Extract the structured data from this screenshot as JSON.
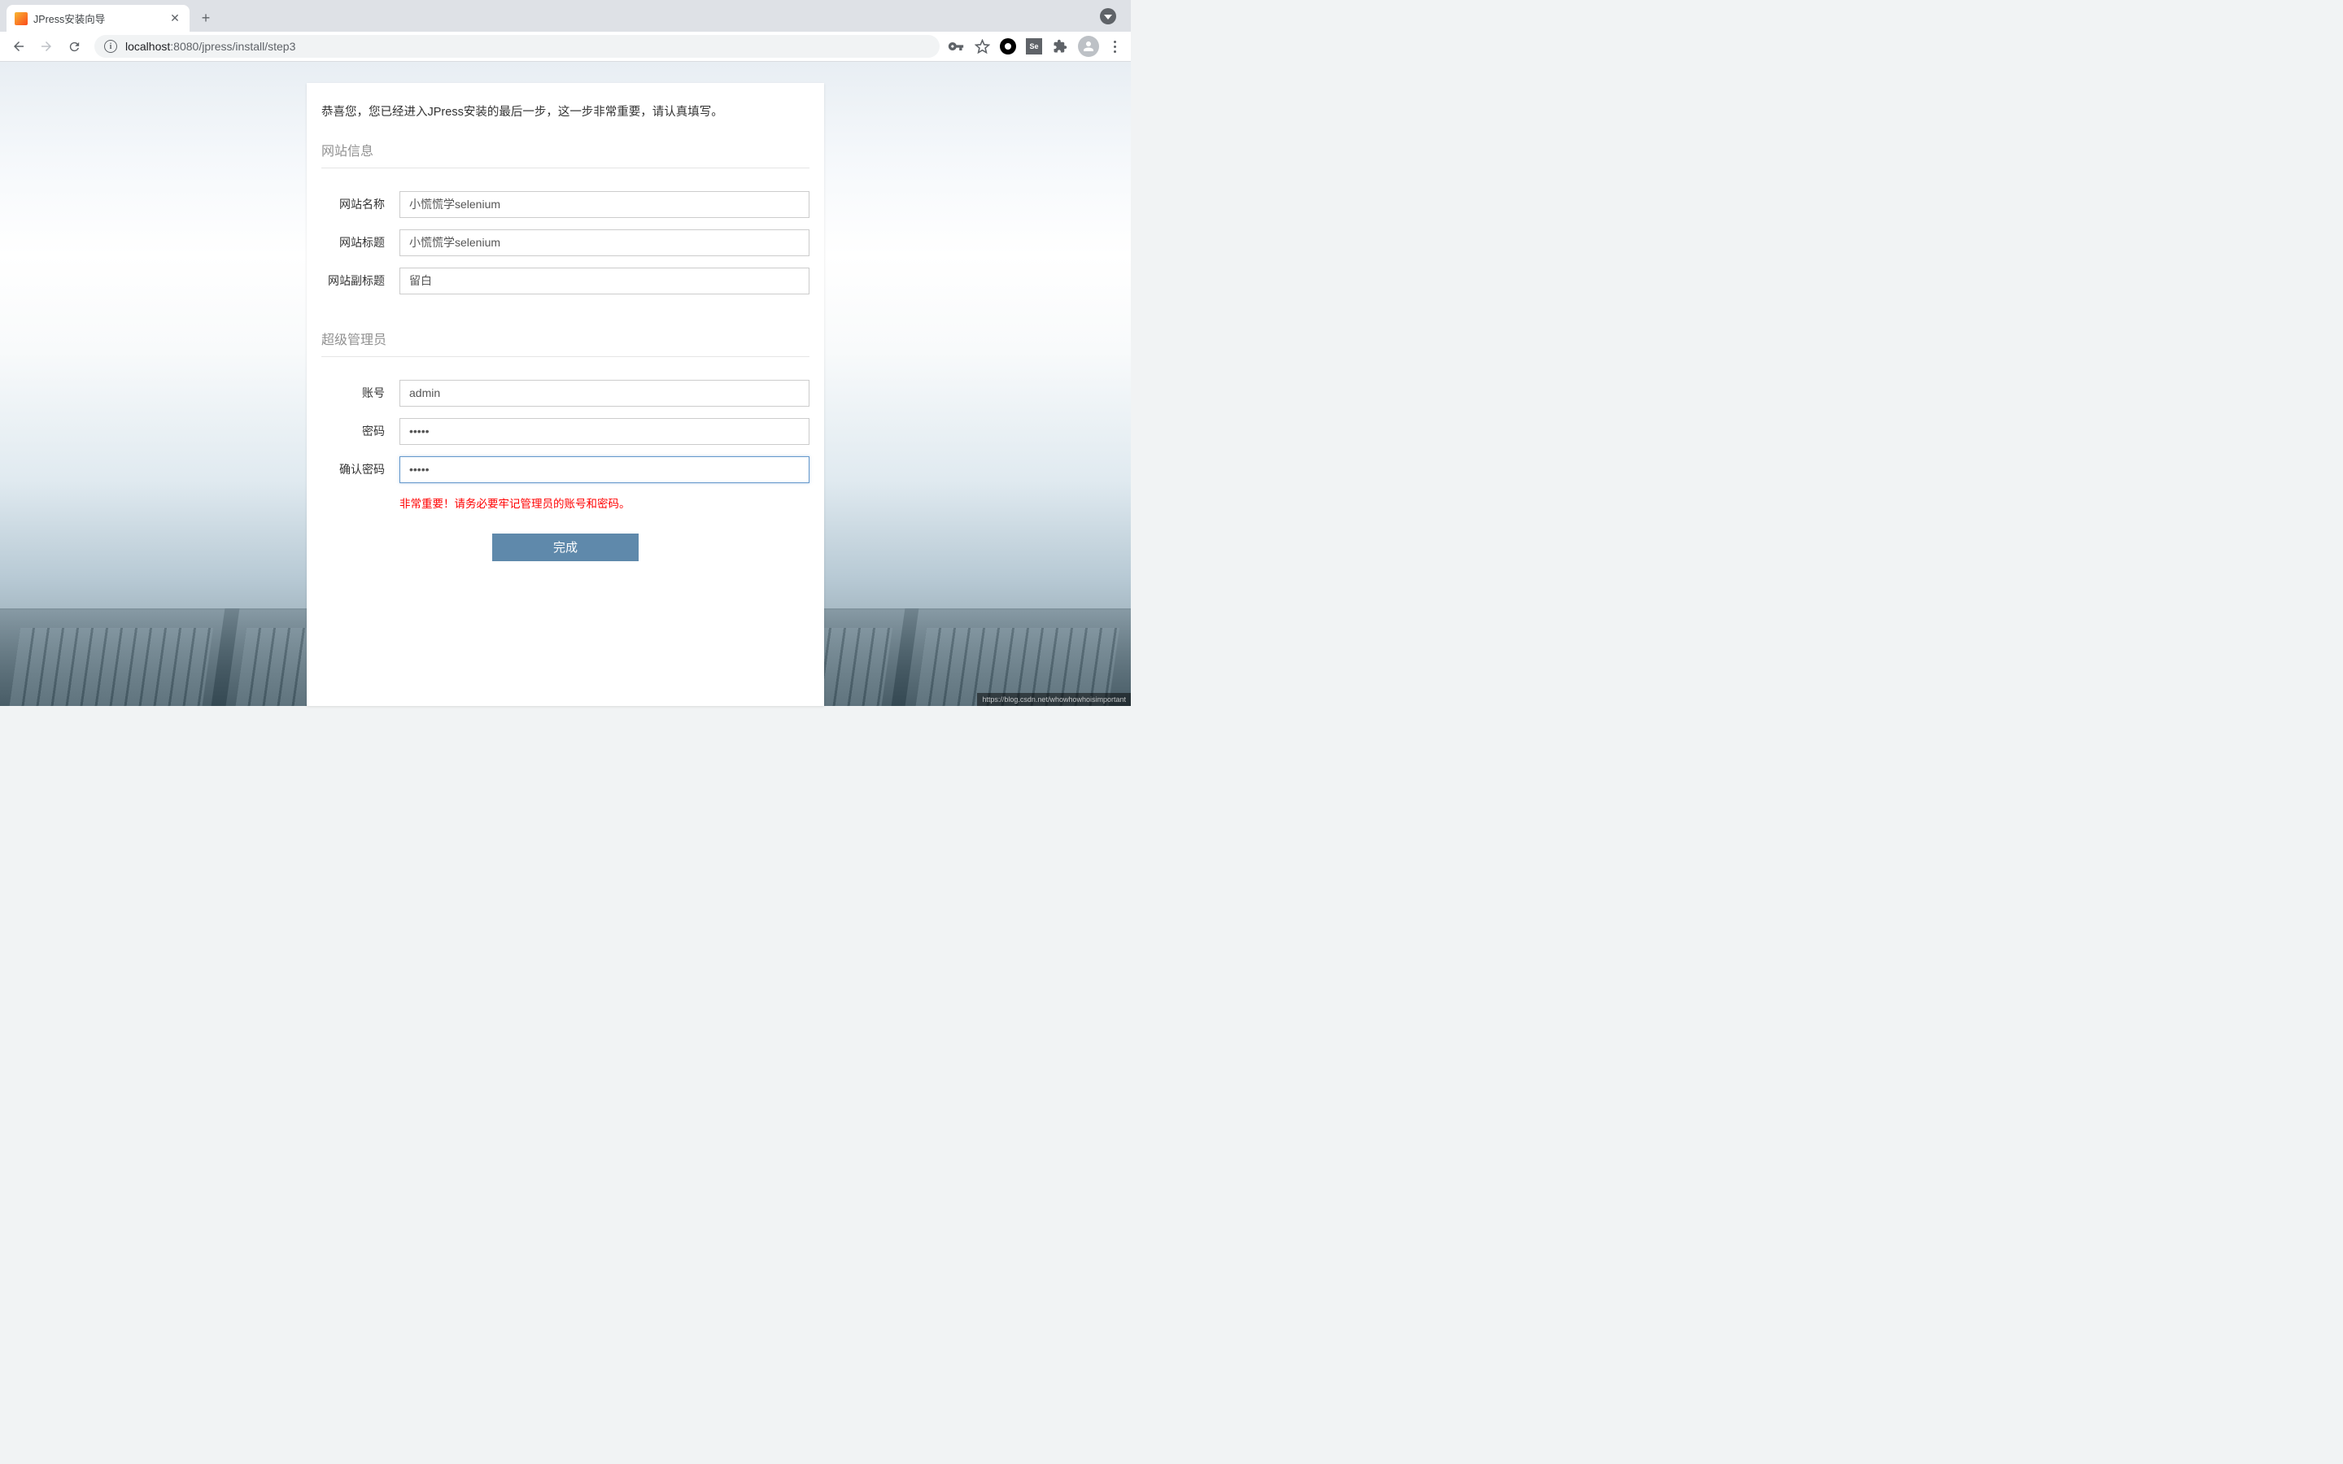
{
  "browser": {
    "tab_title": "JPress安装向导",
    "url_host": "localhost",
    "url_port": ":8080",
    "url_path": "/jpress/install/step3",
    "ext_selenium_label": "Se"
  },
  "wizard": {
    "intro": "恭喜您，您已经进入JPress安装的最后一步，这一步非常重要，请认真填写。",
    "section_site": "网站信息",
    "section_admin": "超级管理员",
    "labels": {
      "site_name": "网站名称",
      "site_title": "网站标题",
      "site_subtitle": "网站副标题",
      "account": "账号",
      "password": "密码",
      "confirm_password": "确认密码"
    },
    "values": {
      "site_name": "小慌慌学selenium",
      "site_title": "小慌慌学selenium",
      "site_subtitle": "留白",
      "account": "admin",
      "password": "•••••",
      "confirm_password": "•••••"
    },
    "warning": "非常重要！请务必要牢记管理员的账号和密码。",
    "submit_label": "完成"
  },
  "watermark": "https://blog.csdn.net/whowhowhoisimportant"
}
